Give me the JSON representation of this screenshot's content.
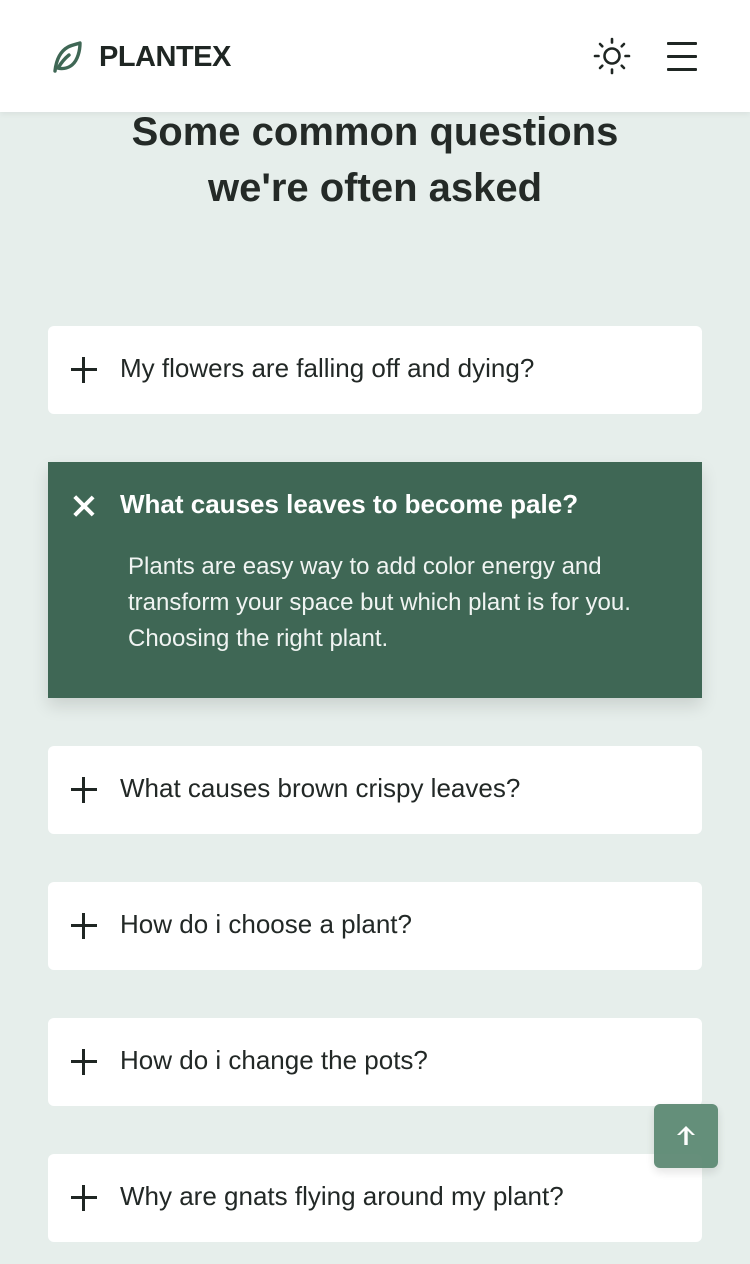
{
  "brand": {
    "name": "PLANTEX",
    "logo_icon": "leaf-icon",
    "accent_color": "#3f6755"
  },
  "header": {
    "theme_icon": "sun-icon",
    "menu_icon": "hamburger-menu-icon"
  },
  "section": {
    "title_line1": "Some common questions",
    "title_line2": "we're often asked"
  },
  "faq": [
    {
      "question": "My flowers are falling off and dying?",
      "expanded": false
    },
    {
      "question": "What causes leaves to become pale?",
      "expanded": true,
      "answer": "Plants are easy way to add color energy and transform your space but which plant is for you. Choosing the right plant."
    },
    {
      "question": "What causes brown crispy leaves?",
      "expanded": false
    },
    {
      "question": "How do i choose a plant?",
      "expanded": false
    },
    {
      "question": "How do i change the pots?",
      "expanded": false
    },
    {
      "question": "Why are gnats flying around my plant?",
      "expanded": false
    }
  ],
  "scroll_up": {
    "icon": "arrow-up-icon"
  }
}
